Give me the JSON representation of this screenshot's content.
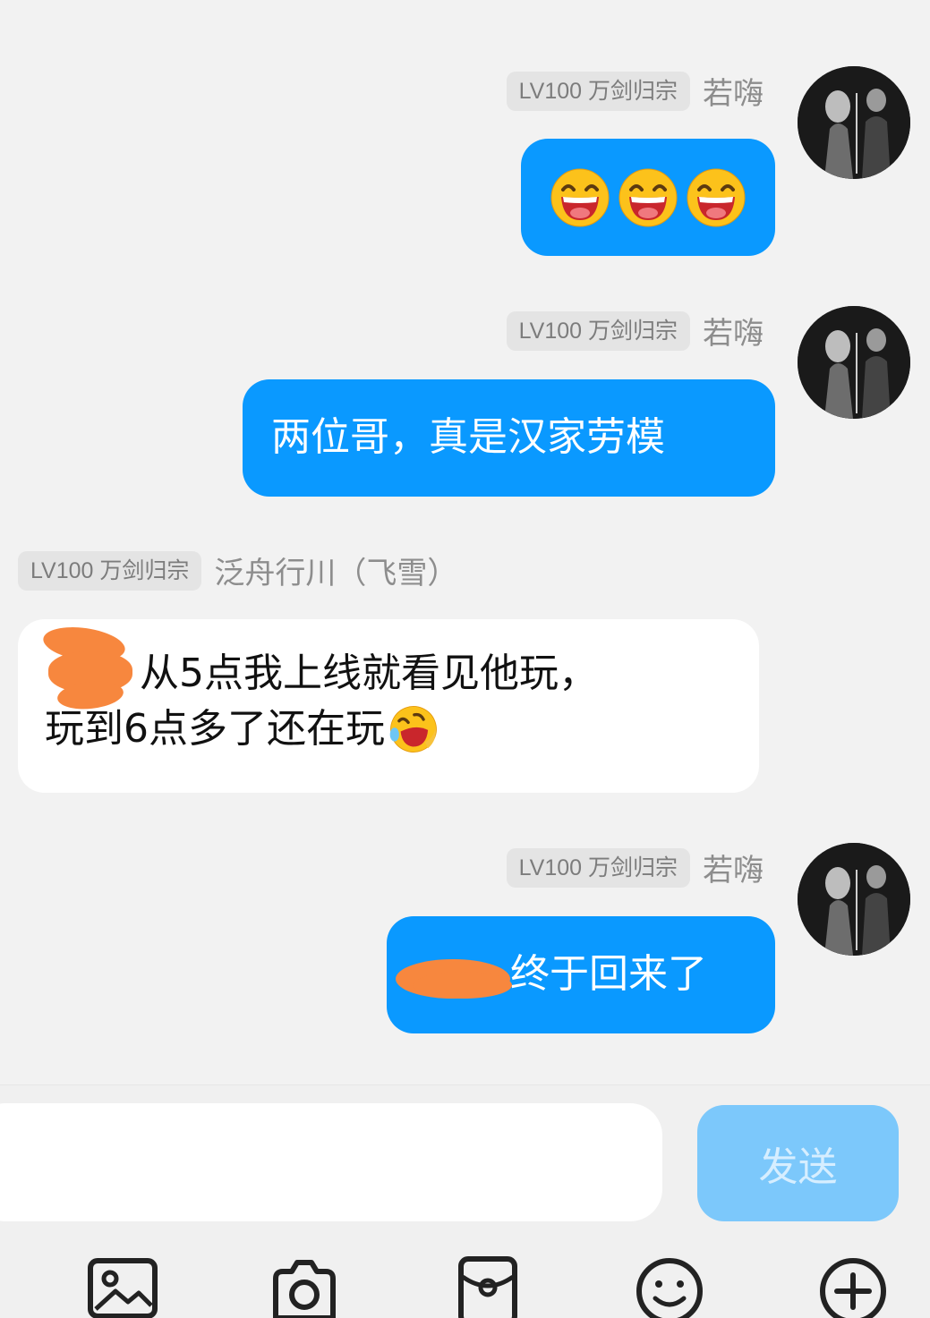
{
  "messages": [
    {
      "side": "me",
      "badge": "LV100 万剑归宗",
      "nickname": "若嗨",
      "content_type": "emoji",
      "emoji_count": 3,
      "emoji_icon": "grinning-face-emoji"
    },
    {
      "side": "me",
      "badge": "LV100 万剑归宗",
      "nickname": "若嗨",
      "text": "两位哥，真是汉家劳模"
    },
    {
      "side": "other",
      "badge": "LV100 万剑归宗",
      "nickname": "泛舟行川（飞雪）",
      "line1": "从5点我上线就看见他玩，",
      "line2": "玩到6点多了还在玩",
      "trailing_emoji": "laughing-tears-emoji"
    },
    {
      "side": "me",
      "badge": "LV100 万剑归宗",
      "nickname": "若嗨",
      "text": "终于回来了"
    }
  ],
  "composer": {
    "input_placeholder": "",
    "send_label": "发送"
  },
  "toolbar": [
    {
      "icon": "image-icon"
    },
    {
      "icon": "camera-icon"
    },
    {
      "icon": "red-packet-icon"
    },
    {
      "icon": "emoji-icon"
    },
    {
      "icon": "plus-icon"
    }
  ],
  "colors": {
    "my_bubble": "#0a99ff",
    "other_bubble": "#ffffff",
    "send_button": "#7cc8fb",
    "background": "#f2f2f2"
  }
}
